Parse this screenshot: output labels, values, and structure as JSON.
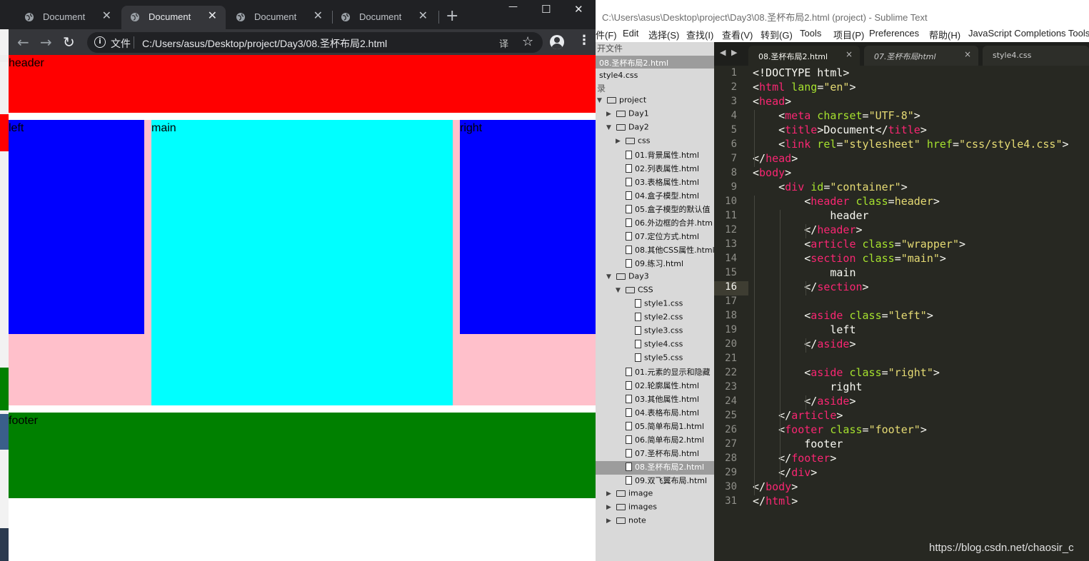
{
  "chrome": {
    "tabs": [
      {
        "label": "Document",
        "close": "✕"
      },
      {
        "label": "Document",
        "close": "✕"
      },
      {
        "label": "Document",
        "close": "✕"
      },
      {
        "label": "Document",
        "close": "✕"
      }
    ],
    "new_tab": "+",
    "window_controls": {
      "minimize": "—",
      "maximize": "☐",
      "close": "✕"
    },
    "nav": {
      "back": "←",
      "forward": "→",
      "reload": "↻"
    },
    "omnibox": {
      "scheme_label": "文件",
      "url": "C:/Users/asus/Desktop/project/Day3/08.圣杯布局2.html"
    },
    "icons": {
      "info": "i",
      "translate": "译",
      "star": "☆",
      "menu": "⋮"
    }
  },
  "page": {
    "header": "header",
    "left": "left",
    "main": "main",
    "right": "right",
    "footer": "footer",
    "colors": {
      "header": "#ff0000",
      "wrapper": "#ffc0cb",
      "left": "#0000ff",
      "main": "#00ffff",
      "right": "#0000ff",
      "footer": "#008000"
    }
  },
  "sublime": {
    "title": "C:\\Users\\asus\\Desktop\\project\\Day3\\08.圣杯布局2.html (project) - Sublime Text",
    "menu": [
      "件(F)",
      "Edit",
      "选择(S)",
      "查找(I)",
      "查看(V)",
      "转到(G)",
      "Tools",
      "项目(P)",
      "Preferences",
      "帮助(H)",
      "JavaScript Completions Tools"
    ],
    "sidebar": {
      "open_files_header": "开文件",
      "open_files": [
        "08.圣杯布局2.html",
        "style4.css"
      ],
      "folders_header": "录",
      "tree": [
        {
          "label": "project",
          "type": "folder-open",
          "depth": 0
        },
        {
          "label": "Day1",
          "type": "folder-closed",
          "depth": 1
        },
        {
          "label": "Day2",
          "type": "folder-open",
          "depth": 1
        },
        {
          "label": "css",
          "type": "folder-closed",
          "depth": 2
        },
        {
          "label": "01.背景属性.html",
          "type": "file",
          "depth": 2
        },
        {
          "label": "02.列表属性.html",
          "type": "file",
          "depth": 2
        },
        {
          "label": "03.表格属性.html",
          "type": "file",
          "depth": 2
        },
        {
          "label": "04.盒子模型.html",
          "type": "file",
          "depth": 2
        },
        {
          "label": "05.盒子模型的默认值",
          "type": "file",
          "depth": 2
        },
        {
          "label": "06.外边框的合并.htm",
          "type": "file",
          "depth": 2
        },
        {
          "label": "07.定位方式.html",
          "type": "file",
          "depth": 2
        },
        {
          "label": "08.其他CSS属性.html",
          "type": "file",
          "depth": 2
        },
        {
          "label": "09.练习.html",
          "type": "file",
          "depth": 2
        },
        {
          "label": "Day3",
          "type": "folder-open",
          "depth": 1
        },
        {
          "label": "CSS",
          "type": "folder-open",
          "depth": 2
        },
        {
          "label": "style1.css",
          "type": "file",
          "depth": 3
        },
        {
          "label": "style2.css",
          "type": "file",
          "depth": 3
        },
        {
          "label": "style3.css",
          "type": "file",
          "depth": 3
        },
        {
          "label": "style4.css",
          "type": "file",
          "depth": 3
        },
        {
          "label": "style5.css",
          "type": "file",
          "depth": 3
        },
        {
          "label": "01.元素的显示和隐藏",
          "type": "file",
          "depth": 2
        },
        {
          "label": "02.轮廓属性.html",
          "type": "file",
          "depth": 2
        },
        {
          "label": "03.其他属性.html",
          "type": "file",
          "depth": 2
        },
        {
          "label": "04.表格布局.html",
          "type": "file",
          "depth": 2
        },
        {
          "label": "05.简单布局1.html",
          "type": "file",
          "depth": 2
        },
        {
          "label": "06.简单布局2.html",
          "type": "file",
          "depth": 2
        },
        {
          "label": "07.圣杯布局.html",
          "type": "file",
          "depth": 2
        },
        {
          "label": "08.圣杯布局2.html",
          "type": "file",
          "depth": 2,
          "selected": true
        },
        {
          "label": "09.双飞翼布局.html",
          "type": "file",
          "depth": 2
        },
        {
          "label": "image",
          "type": "folder-closed",
          "depth": 1
        },
        {
          "label": "images",
          "type": "folder-closed",
          "depth": 1
        },
        {
          "label": "note",
          "type": "folder-closed",
          "depth": 1
        }
      ]
    },
    "tabs": [
      {
        "label": "08.圣杯布局2.html",
        "close": "×"
      },
      {
        "label": "07.圣杯布局html",
        "close": "×"
      },
      {
        "label": "style4.css",
        "close": ""
      }
    ],
    "tab_nav": {
      "prev": "◀",
      "next": "▶"
    },
    "current_line": 16,
    "code_lines": [
      [
        [
          "<!DOCTYPE html>",
          "p"
        ]
      ],
      [
        [
          "<",
          "p"
        ],
        [
          "html",
          "t"
        ],
        [
          " lang",
          "a"
        ],
        [
          "=",
          "p"
        ],
        [
          "\"en\"",
          "s"
        ],
        [
          ">",
          "p"
        ]
      ],
      [
        [
          "<",
          "p"
        ],
        [
          "head",
          "t"
        ],
        [
          ">",
          "p"
        ]
      ],
      [
        [
          "    <",
          "p"
        ],
        [
          "meta",
          "t"
        ],
        [
          " charset",
          "a"
        ],
        [
          "=",
          "p"
        ],
        [
          "\"UTF-8\"",
          "s"
        ],
        [
          ">",
          "p"
        ]
      ],
      [
        [
          "    <",
          "p"
        ],
        [
          "title",
          "t"
        ],
        [
          ">Document</",
          "p"
        ],
        [
          "title",
          "t"
        ],
        [
          ">",
          "p"
        ]
      ],
      [
        [
          "    <",
          "p"
        ],
        [
          "link",
          "t"
        ],
        [
          " rel",
          "a"
        ],
        [
          "=",
          "p"
        ],
        [
          "\"stylesheet\"",
          "s"
        ],
        [
          " href",
          "a"
        ],
        [
          "=",
          "p"
        ],
        [
          "\"css/style4.css\"",
          "s"
        ],
        [
          ">",
          "p"
        ]
      ],
      [
        [
          "</",
          "p"
        ],
        [
          "head",
          "t"
        ],
        [
          ">",
          "p"
        ]
      ],
      [
        [
          "<",
          "p"
        ],
        [
          "body",
          "t"
        ],
        [
          ">",
          "p"
        ]
      ],
      [
        [
          "    <",
          "p"
        ],
        [
          "div",
          "t"
        ],
        [
          " id",
          "a"
        ],
        [
          "=",
          "p"
        ],
        [
          "\"container\"",
          "s"
        ],
        [
          ">",
          "p"
        ]
      ],
      [
        [
          "        <",
          "p"
        ],
        [
          "header",
          "t"
        ],
        [
          " class",
          "a"
        ],
        [
          "=",
          "p"
        ],
        [
          "header",
          "s"
        ],
        [
          ">",
          "p"
        ]
      ],
      [
        [
          "            header",
          "p"
        ]
      ],
      [
        [
          "        </",
          "p"
        ],
        [
          "header",
          "t"
        ],
        [
          ">",
          "p"
        ]
      ],
      [
        [
          "        <",
          "p"
        ],
        [
          "article",
          "t"
        ],
        [
          " class",
          "a"
        ],
        [
          "=",
          "p"
        ],
        [
          "\"wrapper\"",
          "s"
        ],
        [
          ">",
          "p"
        ]
      ],
      [
        [
          "        <",
          "p"
        ],
        [
          "section",
          "t"
        ],
        [
          " class",
          "a"
        ],
        [
          "=",
          "p"
        ],
        [
          "\"main\"",
          "s"
        ],
        [
          ">",
          "p"
        ]
      ],
      [
        [
          "            main",
          "p"
        ]
      ],
      [
        [
          "        </",
          "p"
        ],
        [
          "section",
          "t"
        ],
        [
          ">",
          "p"
        ]
      ],
      [],
      [
        [
          "        <",
          "p"
        ],
        [
          "aside",
          "t"
        ],
        [
          " class",
          "a"
        ],
        [
          "=",
          "p"
        ],
        [
          "\"left\"",
          "s"
        ],
        [
          ">",
          "p"
        ]
      ],
      [
        [
          "            left",
          "p"
        ]
      ],
      [
        [
          "        </",
          "p"
        ],
        [
          "aside",
          "t"
        ],
        [
          ">",
          "p"
        ]
      ],
      [],
      [
        [
          "        <",
          "p"
        ],
        [
          "aside",
          "t"
        ],
        [
          " class",
          "a"
        ],
        [
          "=",
          "p"
        ],
        [
          "\"right\"",
          "s"
        ],
        [
          ">",
          "p"
        ]
      ],
      [
        [
          "            right",
          "p"
        ]
      ],
      [
        [
          "        </",
          "p"
        ],
        [
          "aside",
          "t"
        ],
        [
          ">",
          "p"
        ]
      ],
      [
        [
          "    </",
          "p"
        ],
        [
          "article",
          "t"
        ],
        [
          ">",
          "p"
        ]
      ],
      [
        [
          "    <",
          "p"
        ],
        [
          "footer",
          "t"
        ],
        [
          " class",
          "a"
        ],
        [
          "=",
          "p"
        ],
        [
          "\"footer\"",
          "s"
        ],
        [
          ">",
          "p"
        ]
      ],
      [
        [
          "        footer",
          "p"
        ]
      ],
      [
        [
          "    </",
          "p"
        ],
        [
          "footer",
          "t"
        ],
        [
          ">",
          "p"
        ]
      ],
      [
        [
          "    </",
          "p"
        ],
        [
          "div",
          "t"
        ],
        [
          ">",
          "p"
        ]
      ],
      [
        [
          "</",
          "p"
        ],
        [
          "body",
          "t"
        ],
        [
          ">",
          "p"
        ]
      ],
      [
        [
          "</",
          "p"
        ],
        [
          "html",
          "t"
        ],
        [
          ">",
          "p"
        ]
      ]
    ]
  },
  "watermark": "https://blog.csdn.net/chaosir_c"
}
